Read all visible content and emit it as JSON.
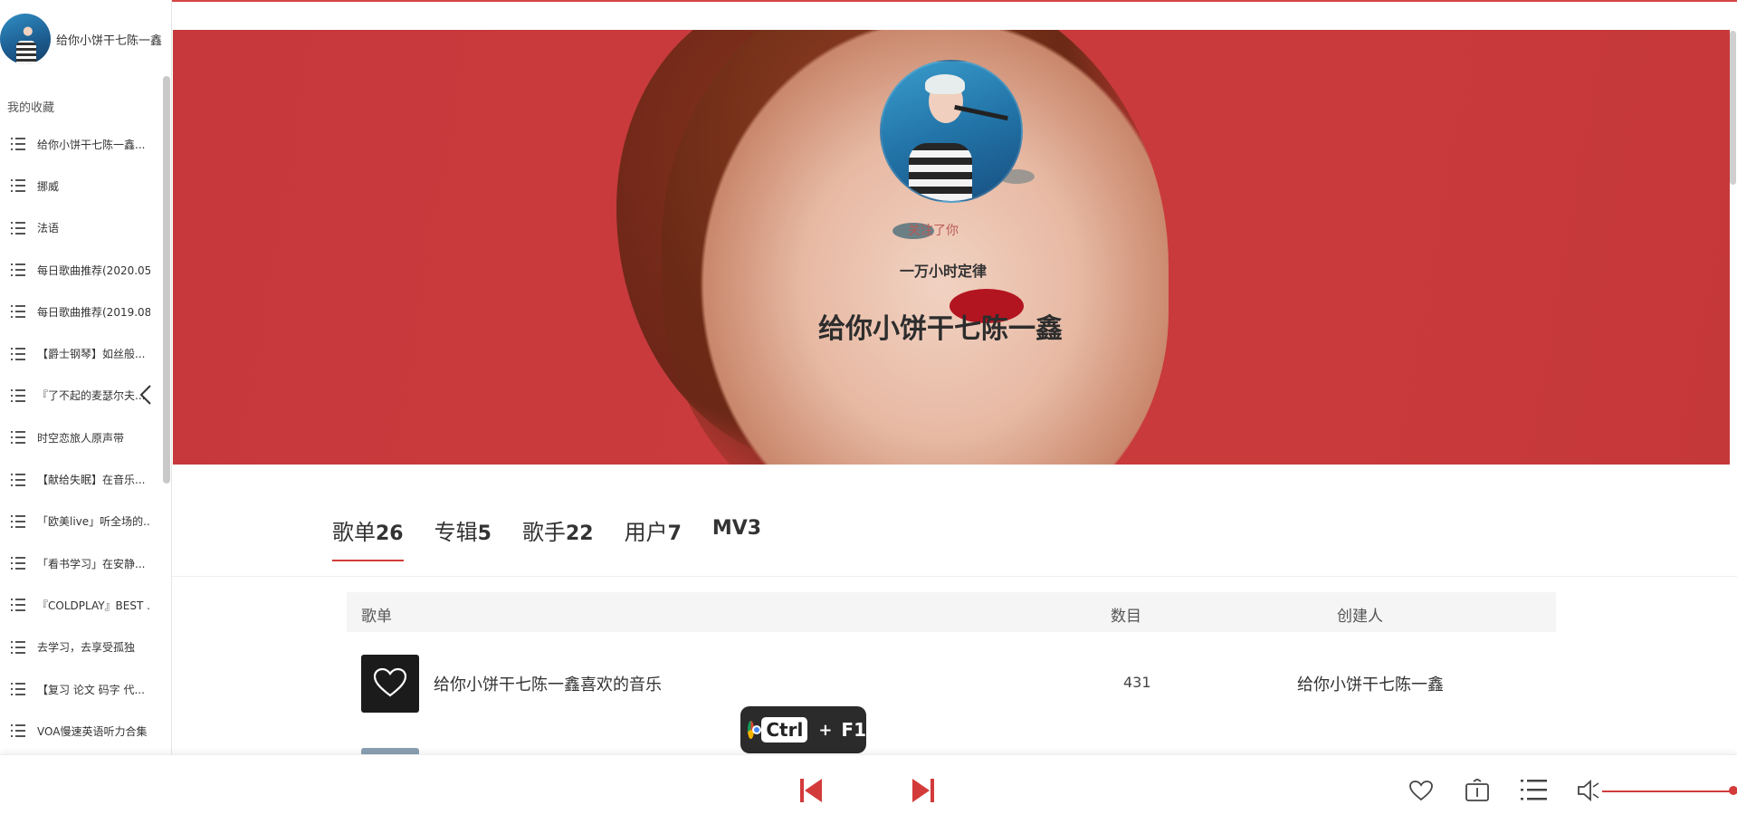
{
  "user": {
    "name": "给你小饼干七陈一鑫"
  },
  "sidebar": {
    "section_title": "我的收藏",
    "items": [
      {
        "label": "给你小饼干七陈一鑫..."
      },
      {
        "label": "挪威"
      },
      {
        "label": "法语"
      },
      {
        "label": "每日歌曲推荐(2020.05..."
      },
      {
        "label": "每日歌曲推荐(2019.08..."
      },
      {
        "label": "【爵士钢琴】如丝般..."
      },
      {
        "label": "『了不起的麦瑟尔夫..."
      },
      {
        "label": "时空恋旅人原声带"
      },
      {
        "label": "【献给失眠】在音乐..."
      },
      {
        "label": "「欧美live」听全场的..."
      },
      {
        "label": "「看书学习」在安静..."
      },
      {
        "label": "『COLDPLAY』BEST ..."
      },
      {
        "label": "去学习，去享受孤独"
      },
      {
        "label": "【复习 论文 码字 代..."
      },
      {
        "label": "VOA慢速英语听力合集"
      }
    ]
  },
  "profile": {
    "follow_label": "关注了你",
    "signature": "一万小时定律",
    "name": "给你小饼干七陈一鑫"
  },
  "tabs": [
    {
      "label": "歌单",
      "count": "26",
      "active": true
    },
    {
      "label": "专辑",
      "count": "5"
    },
    {
      "label": "歌手",
      "count": "22"
    },
    {
      "label": "用户",
      "count": "7"
    },
    {
      "label": "MV",
      "count": "3"
    }
  ],
  "table": {
    "headers": {
      "name": "歌单",
      "count": "数目",
      "creator": "创建人"
    },
    "rows": [
      {
        "name": "给你小饼干七陈一鑫喜欢的音乐",
        "count": "431",
        "creator": "给你小饼干七陈一鑫"
      }
    ]
  },
  "shortcut": {
    "key": "Ctrl",
    "plus": "+",
    "fkey": "F1"
  },
  "colors": {
    "accent": "#d33b3b",
    "banner": "#c93b3d"
  },
  "player": {
    "volume": 1.0
  }
}
